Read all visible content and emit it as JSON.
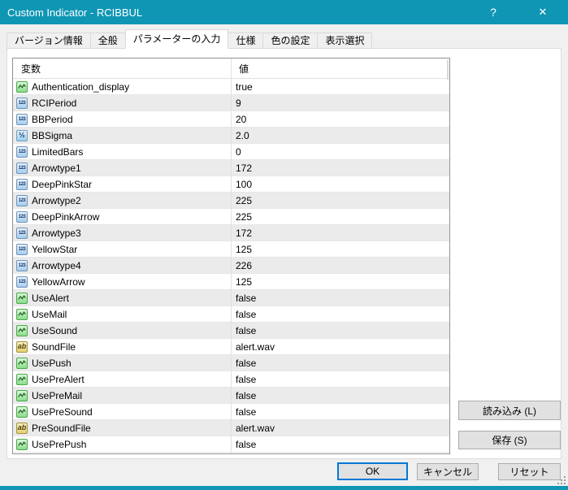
{
  "window": {
    "title": "Custom Indicator - RCIBBUL",
    "help_label": "?",
    "close_label": "✕"
  },
  "tabs": [
    {
      "name": "version-info",
      "label": "バージョン情報",
      "active": false
    },
    {
      "name": "common",
      "label": "全般",
      "active": false
    },
    {
      "name": "inputs",
      "label": "パラメーターの入力",
      "active": true
    },
    {
      "name": "specification",
      "label": "仕様",
      "active": false
    },
    {
      "name": "colors",
      "label": "色の設定",
      "active": false
    },
    {
      "name": "visualization",
      "label": "表示選択",
      "active": false
    }
  ],
  "table": {
    "headers": [
      "変数",
      "値"
    ],
    "rows": [
      {
        "name": "Authentication_display",
        "value": "true",
        "type": "bool"
      },
      {
        "name": "RCIPeriod",
        "value": "9",
        "type": "int"
      },
      {
        "name": "BBPeriod",
        "value": "20",
        "type": "int"
      },
      {
        "name": "BBSigma",
        "value": "2.0",
        "type": "double"
      },
      {
        "name": "LimitedBars",
        "value": "0",
        "type": "int"
      },
      {
        "name": "Arrowtype1",
        "value": "172",
        "type": "int"
      },
      {
        "name": "DeepPinkStar",
        "value": "100",
        "type": "int"
      },
      {
        "name": "Arrowtype2",
        "value": "225",
        "type": "int"
      },
      {
        "name": "DeepPinkArrow",
        "value": "225",
        "type": "int"
      },
      {
        "name": "Arrowtype3",
        "value": "172",
        "type": "int"
      },
      {
        "name": "YellowStar",
        "value": "125",
        "type": "int"
      },
      {
        "name": "Arrowtype4",
        "value": "226",
        "type": "int"
      },
      {
        "name": "YellowArrow",
        "value": "125",
        "type": "int"
      },
      {
        "name": "UseAlert",
        "value": "false",
        "type": "bool"
      },
      {
        "name": "UseMail",
        "value": "false",
        "type": "bool"
      },
      {
        "name": "UseSound",
        "value": "false",
        "type": "bool"
      },
      {
        "name": "SoundFile",
        "value": "alert.wav",
        "type": "string"
      },
      {
        "name": "UsePush",
        "value": "false",
        "type": "bool"
      },
      {
        "name": "UsePreAlert",
        "value": "false",
        "type": "bool"
      },
      {
        "name": "UsePreMail",
        "value": "false",
        "type": "bool"
      },
      {
        "name": "UsePreSound",
        "value": "false",
        "type": "bool"
      },
      {
        "name": "PreSoundFile",
        "value": "alert.wav",
        "type": "string"
      },
      {
        "name": "UsePrePush",
        "value": "false",
        "type": "bool"
      }
    ]
  },
  "icons": {
    "bool": {
      "name": "bool-param-icon",
      "glyph": ""
    },
    "int": {
      "name": "int-param-icon",
      "glyph": "123"
    },
    "double": {
      "name": "double-param-icon",
      "glyph": "½"
    },
    "string": {
      "name": "string-param-icon",
      "glyph": "ab"
    }
  },
  "side_buttons": {
    "load": "読み込み (L)",
    "save": "保存 (S)"
  },
  "footer_buttons": {
    "ok": "OK",
    "cancel": "キャンセル",
    "reset": "リセット"
  },
  "colors": {
    "titlebar": "#0f96b4",
    "row_alt": "#ebebeb",
    "ok_border": "#0078d7",
    "button_bg": "#e1e1e1"
  }
}
